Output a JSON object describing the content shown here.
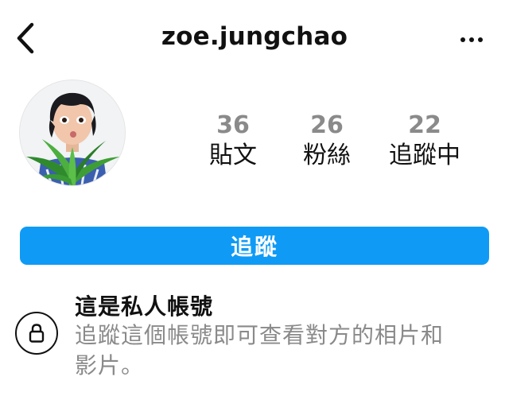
{
  "header": {
    "back_icon": "chevron-left-icon",
    "username": "zoe.jungchao",
    "more_icon": "more-dots-icon"
  },
  "profile": {
    "avatar_alt": "",
    "stats": [
      {
        "count": "36",
        "label": "貼文"
      },
      {
        "count": "26",
        "label": "粉絲"
      },
      {
        "count": "22",
        "label": "追蹤中"
      }
    ]
  },
  "actions": {
    "follow_label": "追蹤"
  },
  "private_notice": {
    "icon": "lock-icon",
    "title": "這是私人帳號",
    "description": "追蹤這個帳號即可查看對方的相片和影片。"
  },
  "colors": {
    "accent": "#0f9bf5",
    "text_primary": "#111111",
    "text_secondary": "#8a8a8a",
    "background": "#ffffff"
  }
}
